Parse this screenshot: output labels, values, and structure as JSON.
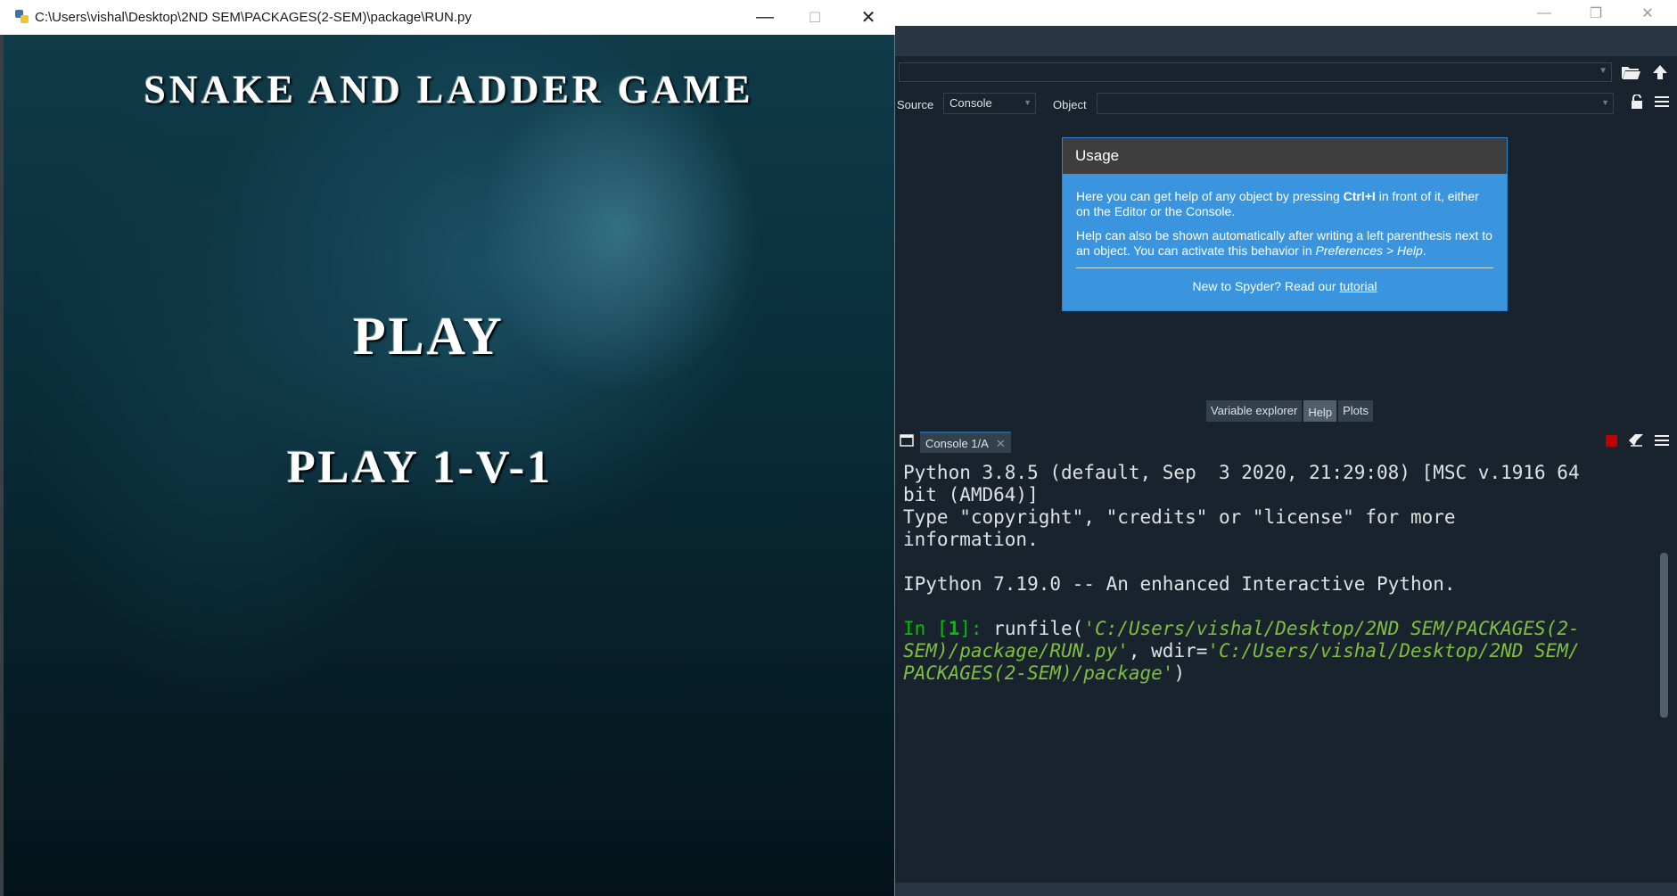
{
  "game_window": {
    "title": "C:\\Users\\vishal\\Desktop\\2ND SEM\\PACKAGES(2-SEM)\\package\\RUN.py",
    "controls": {
      "minimize": "—",
      "maximize": "☐",
      "close": "✕"
    },
    "heading": "Snake and Ladder Game",
    "play_label": "Play",
    "play_1v1_label": "Play 1-v-1"
  },
  "spyder": {
    "window_controls": {
      "minimize": "—",
      "restore": "❐",
      "close": "✕"
    },
    "toolbar_icons": [
      "folder-open-icon",
      "arrow-up-icon"
    ],
    "help": {
      "source_label": "Source",
      "source_value": "Console",
      "object_label": "Object",
      "object_value": "",
      "usage_title": "Usage",
      "usage_p1_a": "Here you can get help of any object by pressing ",
      "usage_p1_key": "Ctrl+I",
      "usage_p1_b": " in front of it, either on the Editor or the Console.",
      "usage_p2_a": "Help can also be shown automatically after writing a left parenthesis next to an object. You can activate this behavior in ",
      "usage_p2_pref": "Preferences > Help",
      "usage_p2_b": ".",
      "usage_footer_a": "New to Spyder? Read our ",
      "usage_footer_link": "tutorial"
    },
    "pane_tabs": [
      {
        "label": "Variable explorer",
        "active": false
      },
      {
        "label": "Help",
        "active": true
      },
      {
        "label": "Plots",
        "active": false
      }
    ],
    "console": {
      "tab_label": "Console 1/A",
      "line1": "Python 3.8.5 (default, Sep  3 2020, 21:29:08) [MSC v.1916 64",
      "line2": "bit (AMD64)]",
      "line3": "Type \"copyright\", \"credits\" or \"license\" for more",
      "line4": "information.",
      "line5": "IPython 7.19.0 -- An enhanced Interactive Python.",
      "prompt_in": "In [",
      "prompt_num": "1",
      "prompt_close": "]: ",
      "cmd_a": "runfile(",
      "cmd_str1a": "'C:/Users/vishal/Desktop/2ND SEM/PACKAGES(2-",
      "cmd_str1b": "SEM)/package/RUN.py'",
      "cmd_b": ", wdir=",
      "cmd_str2a": "'C:/Users/vishal/Desktop/2ND SEM/",
      "cmd_str2b": "PACKAGES(2-SEM)/package'",
      "cmd_c": ")"
    }
  }
}
